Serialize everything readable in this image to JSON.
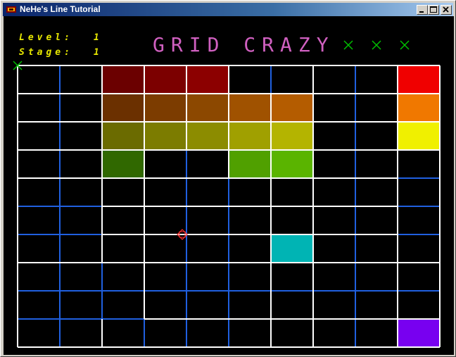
{
  "window": {
    "title": "NeHe's Line Tutorial",
    "icon": "opengl-app-icon",
    "controls": [
      "minimize-icon",
      "maximize-icon",
      "close-icon"
    ]
  },
  "hud": {
    "level_label": "Level:",
    "level_value": "1",
    "stage_label": "Stage:",
    "stage_value": "1",
    "game_title": "GRID CRAZY",
    "lives_remaining": 3,
    "level_color": "#e8e800",
    "title_color": "#d060c0",
    "lives_color": "#00c000"
  },
  "board": {
    "columns": 10,
    "rows": 10,
    "filled_line_color": "#ffffff",
    "unfilled_line_color": "#2060e0",
    "background_color": "#000000",
    "horizontal_filled": [
      [
        true,
        true,
        true,
        true,
        true,
        true,
        true,
        true,
        true,
        true
      ],
      [
        true,
        true,
        true,
        true,
        true,
        true,
        true,
        true,
        true,
        true
      ],
      [
        true,
        true,
        true,
        true,
        true,
        true,
        true,
        true,
        true,
        true
      ],
      [
        true,
        true,
        true,
        true,
        true,
        true,
        true,
        true,
        true,
        true
      ],
      [
        true,
        true,
        true,
        true,
        true,
        true,
        true,
        true,
        true,
        false
      ],
      [
        false,
        false,
        true,
        true,
        true,
        true,
        true,
        true,
        true,
        false
      ],
      [
        false,
        false,
        true,
        true,
        true,
        true,
        true,
        true,
        true,
        false
      ],
      [
        true,
        true,
        true,
        true,
        true,
        true,
        true,
        true,
        true,
        true
      ],
      [
        false,
        false,
        false,
        false,
        false,
        false,
        false,
        false,
        false,
        false
      ],
      [
        false,
        false,
        false,
        true,
        true,
        true,
        true,
        true,
        true,
        true
      ],
      [
        true,
        true,
        true,
        true,
        true,
        true,
        true,
        true,
        true,
        true
      ]
    ],
    "vertical_filled": [
      [
        true,
        true,
        true,
        true,
        true,
        true,
        true,
        true,
        true,
        true
      ],
      [
        false,
        false,
        false,
        false,
        false,
        false,
        false,
        false,
        false,
        false
      ],
      [
        true,
        true,
        true,
        true,
        true,
        true,
        true,
        false,
        false,
        true
      ],
      [
        true,
        true,
        true,
        true,
        true,
        true,
        true,
        true,
        true,
        false
      ],
      [
        true,
        true,
        true,
        false,
        false,
        false,
        false,
        false,
        false,
        false
      ],
      [
        true,
        true,
        true,
        true,
        false,
        false,
        false,
        false,
        false,
        false
      ],
      [
        false,
        true,
        true,
        true,
        true,
        true,
        true,
        true,
        true,
        true
      ],
      [
        true,
        true,
        true,
        true,
        true,
        true,
        true,
        true,
        true,
        true
      ],
      [
        false,
        false,
        false,
        false,
        false,
        false,
        false,
        false,
        false,
        false
      ],
      [
        true,
        true,
        true,
        true,
        true,
        true,
        true,
        true,
        true,
        true
      ],
      [
        true,
        true,
        true,
        true,
        true,
        true,
        true,
        true,
        true,
        true
      ]
    ],
    "filled_cells": [
      {
        "col": 2,
        "row": 0,
        "color": "#6b0000"
      },
      {
        "col": 3,
        "row": 0,
        "color": "#7c0000"
      },
      {
        "col": 4,
        "row": 0,
        "color": "#8c0000"
      },
      {
        "col": 9,
        "row": 0,
        "color": "#f00000"
      },
      {
        "col": 2,
        "row": 1,
        "color": "#6b3000"
      },
      {
        "col": 3,
        "row": 1,
        "color": "#7c3c00"
      },
      {
        "col": 4,
        "row": 1,
        "color": "#8c4800"
      },
      {
        "col": 5,
        "row": 1,
        "color": "#a05200"
      },
      {
        "col": 6,
        "row": 1,
        "color": "#b45c00"
      },
      {
        "col": 9,
        "row": 1,
        "color": "#f07800"
      },
      {
        "col": 2,
        "row": 2,
        "color": "#6b6b00"
      },
      {
        "col": 3,
        "row": 2,
        "color": "#7c7c00"
      },
      {
        "col": 4,
        "row": 2,
        "color": "#8c8c00"
      },
      {
        "col": 5,
        "row": 2,
        "color": "#a0a000"
      },
      {
        "col": 6,
        "row": 2,
        "color": "#b4b400"
      },
      {
        "col": 9,
        "row": 2,
        "color": "#f0f000"
      },
      {
        "col": 2,
        "row": 3,
        "color": "#306800"
      },
      {
        "col": 5,
        "row": 3,
        "color": "#50a000"
      },
      {
        "col": 6,
        "row": 3,
        "color": "#5ab400"
      },
      {
        "col": 6,
        "row": 6,
        "color": "#00b4b4"
      },
      {
        "col": 9,
        "row": 9,
        "color": "#7800f0"
      }
    ],
    "player": {
      "node_col": 4,
      "node_row": 6,
      "color": "#ff3030"
    },
    "enemy": {
      "node_col": 0,
      "node_row": 0,
      "color": "#00c000"
    }
  }
}
